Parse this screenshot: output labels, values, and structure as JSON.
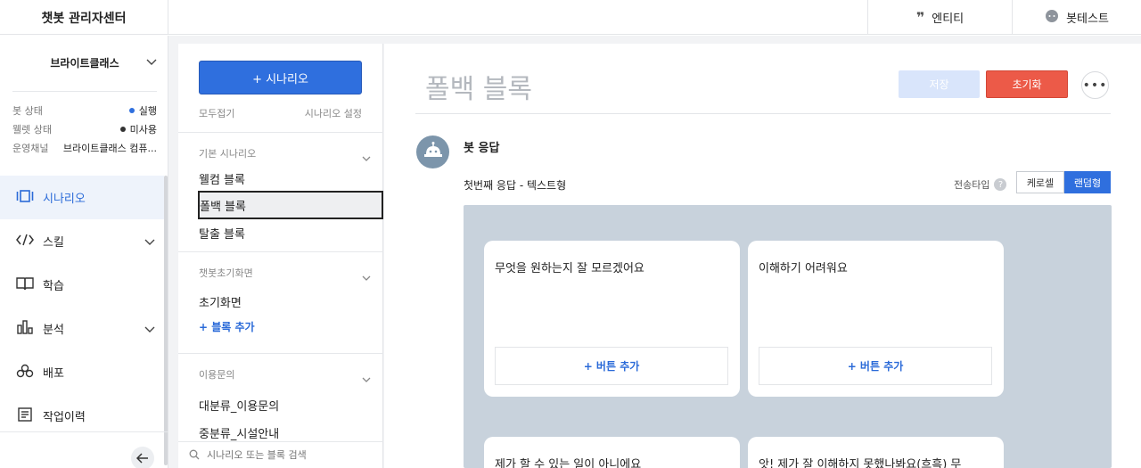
{
  "app": {
    "title": "챗봇 관리자센터"
  },
  "topbar": {
    "entity_label": "엔티티",
    "bottest_label": "봇테스트"
  },
  "sidebar": {
    "bot_name": "브라이트클래스",
    "info": [
      {
        "key": "봇 상태",
        "value": "실행",
        "dot_color": "#2f6fde"
      },
      {
        "key": "웰렛 상태",
        "value": "미사용",
        "dot_color": "#333333"
      },
      {
        "key": "운영채널",
        "value": "브라이트클래스 컴퓨..."
      }
    ],
    "nav": [
      {
        "label": "시나리오",
        "icon": "scenario-icon",
        "active": true
      },
      {
        "label": "스킬",
        "icon": "code-icon"
      },
      {
        "label": "학습",
        "icon": "book-icon"
      },
      {
        "label": "분석",
        "icon": "chart-icon"
      },
      {
        "label": "배포",
        "icon": "deploy-icon"
      },
      {
        "label": "작업이력",
        "icon": "history-icon"
      }
    ]
  },
  "scenario_panel": {
    "add_button": "+ 시나리오",
    "collapse_all": "모두접기",
    "settings": "시나리오 설정",
    "groups": [
      {
        "title": "기본 시나리오",
        "items": [
          "웰컴 블록",
          "폴백 블록",
          "탈출 블록"
        ]
      },
      {
        "title": "챗봇초기화면",
        "items": [
          "초기화면"
        ],
        "add_block": "+ 블록 추가"
      },
      {
        "title": "이용문의",
        "items": [
          "대분류_이용문의",
          "중분류_시설안내"
        ]
      }
    ],
    "search_placeholder": "시나리오 또는 블록 검색"
  },
  "main": {
    "title": "폴백 블록",
    "save": "저장",
    "reset": "초기화",
    "more": "•••",
    "bot_response": "봇 응답",
    "response_subtitle": "첫번째 응답 - 텍스트형",
    "send_type_label": "전송타입",
    "send_type_options": [
      "케로셀",
      "랜덤형"
    ],
    "send_type_selected": "랜덤형",
    "cards": [
      {
        "text": "무엇을 원하는지 잘 모르겠어요",
        "button": "+ 버튼 추가"
      },
      {
        "text": "이해하기 어려워요",
        "button": "+ 버튼 추가"
      },
      {
        "text": "제가 할 수 있는 일이 아니에요"
      },
      {
        "text": "앗! 제가 잘 이해하지 못했나봐요(흐흑) 무"
      }
    ]
  }
}
